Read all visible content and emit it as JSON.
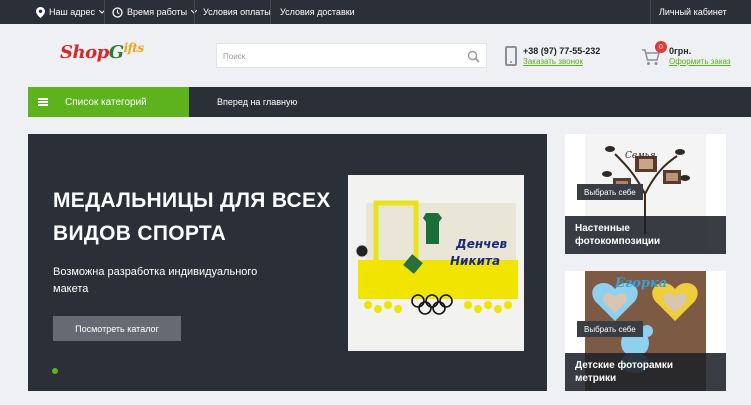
{
  "topbar": {
    "address": "Наш адрес",
    "hours": "Время работы",
    "payment": "Условия оплаты",
    "delivery": "Условия доставки",
    "account": "Личный кабинет"
  },
  "header": {
    "logo_text": "ShopGifts",
    "search_placeholder": "Поиск",
    "phone": "+38 (97) 77-55-232",
    "callback": "Заказать звонок",
    "cart_count": "0",
    "cart_sum": "0грн.",
    "checkout": "Оформить заказ"
  },
  "nav": {
    "categories": "Список категорий",
    "home": "Вперед на главную"
  },
  "slider": {
    "title": "МЕДАЛЬНИЦЫ ДЛЯ ВСЕХ ВИДОВ СПОРТА",
    "subtitle": "Возможна разработка индивидуального макета",
    "button": "Посмотреть каталог",
    "image_caption_name": "Денчев",
    "image_caption_name2": "Никита"
  },
  "cards": [
    {
      "choose": "Выбрать себе",
      "caption": "Настенные фотокомпозиции",
      "picture_text": "Семья"
    },
    {
      "choose": "Выбрать себе",
      "caption": "Детские фоторамки метрики",
      "picture_text": "Егорка"
    }
  ],
  "colors": {
    "accent": "#5cb31e",
    "dark": "#2b2f38",
    "badge": "#e53935"
  }
}
